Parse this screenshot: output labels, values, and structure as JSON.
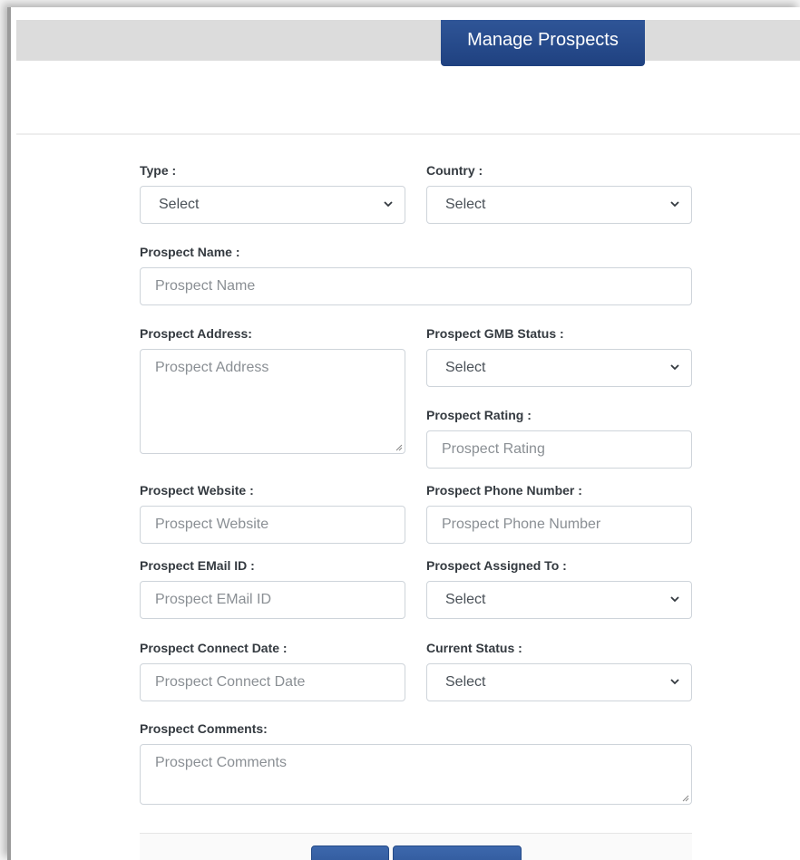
{
  "header": {
    "tab_label": "Manage Prospects"
  },
  "fields": {
    "type": {
      "label": "Type :",
      "value": "Select"
    },
    "country": {
      "label": "Country :",
      "value": "Select"
    },
    "prospect_name": {
      "label": "Prospect Name :",
      "placeholder": "Prospect Name"
    },
    "prospect_address": {
      "label": "Prospect Address:",
      "placeholder": "Prospect Address"
    },
    "gmb_status": {
      "label": "Prospect GMB Status :",
      "value": "Select"
    },
    "rating": {
      "label": "Prospect Rating :",
      "placeholder": "Prospect Rating"
    },
    "website": {
      "label": "Prospect Website :",
      "placeholder": "Prospect Website"
    },
    "phone": {
      "label": "Prospect Phone Number :",
      "placeholder": "Prospect Phone Number"
    },
    "email": {
      "label": "Prospect EMail ID :",
      "placeholder": "Prospect EMail ID"
    },
    "assigned_to": {
      "label": "Prospect Assigned To :",
      "value": "Select"
    },
    "connect_date": {
      "label": "Prospect Connect Date :",
      "placeholder": "Prospect Connect Date"
    },
    "current_status": {
      "label": "Current Status :",
      "value": "Select"
    },
    "comments": {
      "label": "Prospect Comments:",
      "placeholder": "Prospect Comments"
    }
  },
  "icons": {
    "select_arrow": "chevron-down-icon",
    "resize": "resize-grip-icon"
  }
}
